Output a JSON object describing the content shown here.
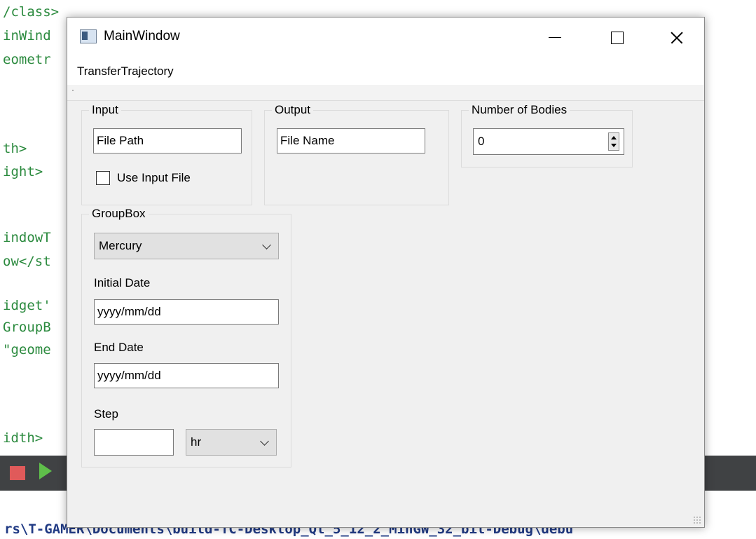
{
  "background": {
    "code_lines": [
      "/class>",
      "inWind",
      "eometr",
      "th>",
      "ight>",
      "indowT",
      "ow</st",
      "idget'",
      "GroupB",
      "\"geome",
      "idth>"
    ],
    "status_path": "rs\\T-GAMER\\Documents\\build-TC-Desktop_Qt_5_12_2_MinGW_32_bit-Debug\\debu"
  },
  "window": {
    "title": "MainWindow",
    "menu": [
      "TransferTrajectory"
    ],
    "input_group": {
      "title": "Input",
      "file_path": "File Path",
      "use_input_file_label": "Use Input File",
      "use_input_file_checked": false
    },
    "output_group": {
      "title": "Output",
      "file_name": "File Name"
    },
    "bodies_group": {
      "title": "Number of Bodies",
      "value": "0"
    },
    "groupbox": {
      "title": "GroupBox",
      "planet": "Mercury",
      "initial_date_label": "Initial Date",
      "initial_date_value": "yyyy/mm/dd",
      "end_date_label": "End Date",
      "end_date_value": "yyyy/mm/dd",
      "step_label": "Step",
      "step_value": "",
      "step_unit": "hr"
    }
  },
  "colors": {
    "code_text": "#2b8a3e",
    "status_text": "#203a84",
    "window_bg": "#f0f0f0"
  }
}
